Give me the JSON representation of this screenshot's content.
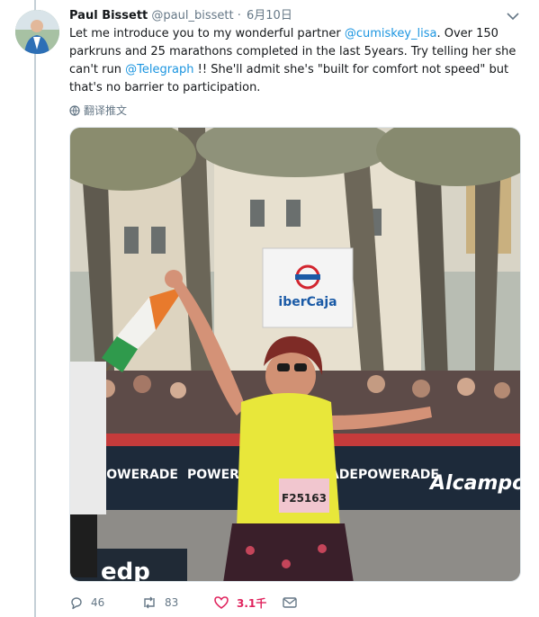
{
  "tweet": {
    "author_name": "Paul Bissett",
    "author_handle": "@paul_bissett",
    "separator": "·",
    "date": "6月10日",
    "text_1": "Let me introduce you to my wonderful partner ",
    "mention_1": "@cumiskey_lisa",
    "text_2": ". Over 150 parkruns and 25 marathons completed in the last 5years. Try telling her she can't run ",
    "mention_2": "@Telegraph",
    "text_3": " !! She'll admit she's \"built for comfort not speed\" but that's no barrier to participation.",
    "translate_label": "翻译推文"
  },
  "photo": {
    "sign_text": "iberCaja",
    "bib_number": "F25163",
    "banner_texts": [
      "POWERADE",
      "POWERADE",
      "POWERADE",
      "POWERADE",
      "Alcampo"
    ],
    "ground_text": "edp"
  },
  "actions": {
    "reply_count": "46",
    "retweet_count": "83",
    "like_count": "3.1千"
  },
  "colors": {
    "link": "#1b95e0",
    "liked": "#e0245e",
    "muted": "#657786"
  },
  "icons": [
    "caret-down-icon",
    "globe-icon",
    "reply-icon",
    "retweet-icon",
    "heart-icon",
    "message-icon"
  ]
}
